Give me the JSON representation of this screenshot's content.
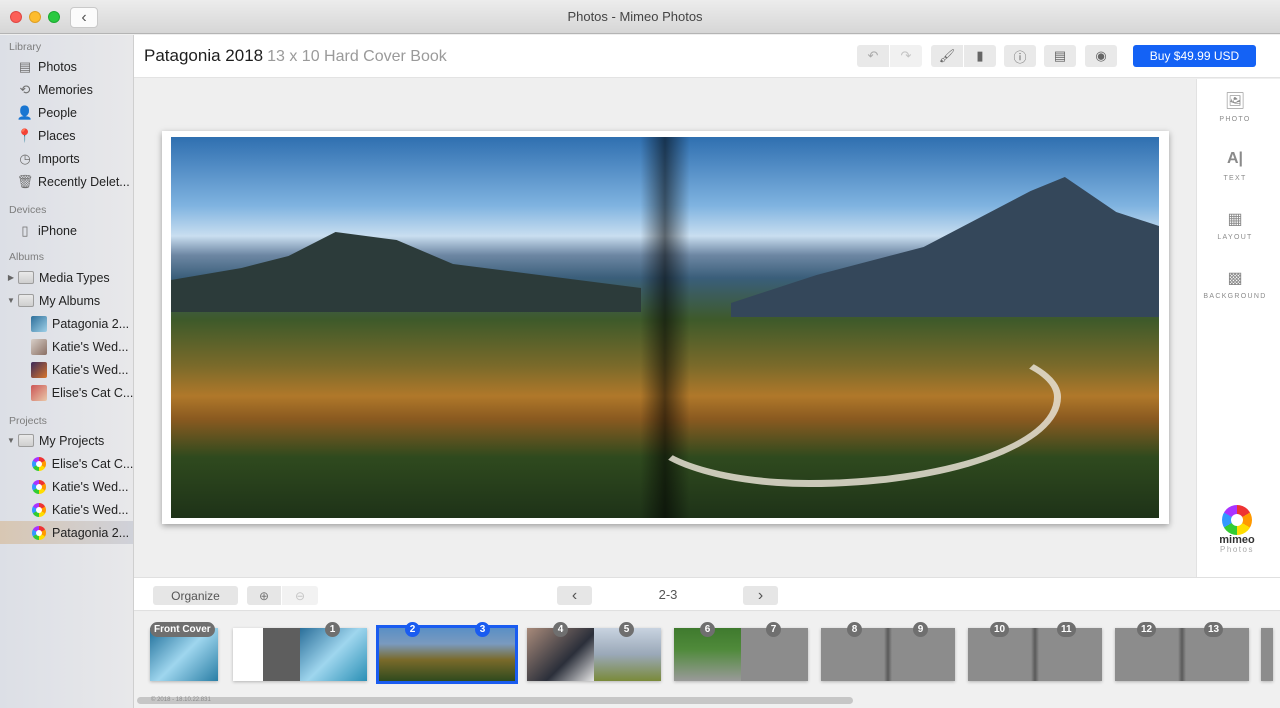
{
  "window": {
    "title": "Photos - Mimeo Photos"
  },
  "sidebar": {
    "sections": {
      "library": "Library",
      "devices": "Devices",
      "albums": "Albums",
      "projects": "Projects"
    },
    "library": [
      {
        "label": "Photos",
        "icon": "photos-icon"
      },
      {
        "label": "Memories",
        "icon": "memories-icon"
      },
      {
        "label": "People",
        "icon": "people-icon"
      },
      {
        "label": "Places",
        "icon": "places-icon"
      },
      {
        "label": "Imports",
        "icon": "imports-icon"
      },
      {
        "label": "Recently Delet...",
        "icon": "trash-icon"
      }
    ],
    "devices": [
      {
        "label": "iPhone",
        "icon": "iphone-icon"
      }
    ],
    "albums": [
      {
        "label": "Media Types",
        "expanded": false
      },
      {
        "label": "My Albums",
        "expanded": true,
        "children": [
          "Patagonia 2...",
          "Katie's Wed...",
          "Katie's Wed...",
          "Elise's Cat C..."
        ]
      }
    ],
    "projects": [
      {
        "label": "My Projects",
        "expanded": true,
        "children": [
          "Elise's Cat C...",
          "Katie's Wed...",
          "Katie's Wed...",
          "Patagonia 2..."
        ],
        "selected_index": 3
      }
    ]
  },
  "header": {
    "title": "Patagonia 2018",
    "subtitle": "13 x 10 Hard Cover Book",
    "buy_label": "Buy $49.99 USD",
    "accent": "#1462f5"
  },
  "right_tools": [
    "PHOTO",
    "TEXT",
    "LAYOUT",
    "BACKGROUND"
  ],
  "logo": {
    "name": "mimeo",
    "sub": "Photos"
  },
  "bottombar": {
    "organize": "Organize",
    "page_label": "2-3"
  },
  "filmstrip": {
    "front_cover": "Front Cover",
    "spreads": [
      {
        "left": "",
        "right": "1",
        "selected": false
      },
      {
        "left": "2",
        "right": "3",
        "selected": true
      },
      {
        "left": "4",
        "right": "5",
        "selected": false
      },
      {
        "left": "6",
        "right": "7",
        "selected": false
      },
      {
        "left": "8",
        "right": "9",
        "selected": false
      },
      {
        "left": "10",
        "right": "11",
        "selected": false
      },
      {
        "left": "12",
        "right": "13",
        "selected": false
      }
    ],
    "version": "© 2018 - 18.10.22.831"
  }
}
